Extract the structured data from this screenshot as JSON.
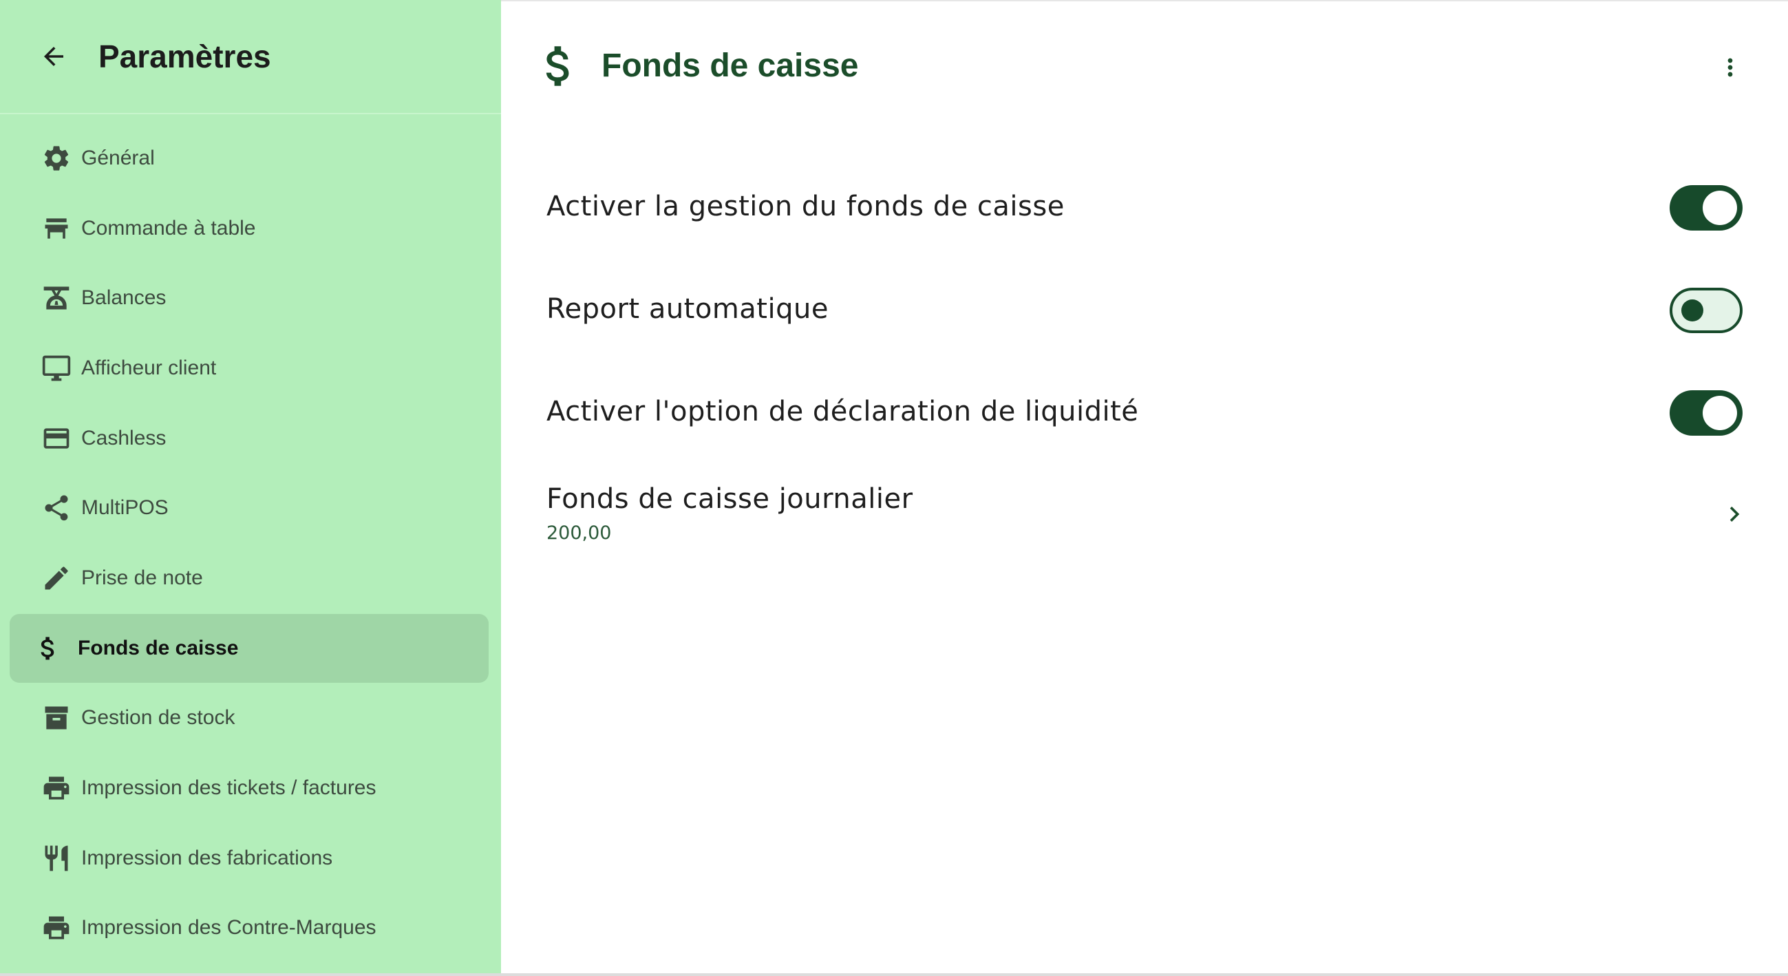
{
  "colors": {
    "sidebar_bg": "#b3eeba",
    "sidebar_active": "#9fd6a6",
    "accent": "#174a2b",
    "title": "#1b4d2a"
  },
  "sidebar": {
    "back_icon": "arrow-back-icon",
    "title": "Paramètres",
    "items": [
      {
        "label": "Général",
        "icon": "gear-icon",
        "active": false
      },
      {
        "label": "Commande à table",
        "icon": "table-icon",
        "active": false
      },
      {
        "label": "Balances",
        "icon": "scale-icon",
        "active": false
      },
      {
        "label": "Afficheur client",
        "icon": "monitor-icon",
        "active": false
      },
      {
        "label": "Cashless",
        "icon": "credit-card-icon",
        "active": false
      },
      {
        "label": "MultiPOS",
        "icon": "share-icon",
        "active": false
      },
      {
        "label": "Prise de note",
        "icon": "pencil-icon",
        "active": false
      },
      {
        "label": "Fonds de caisse",
        "icon": "dollar-icon",
        "active": true
      },
      {
        "label": "Gestion de stock",
        "icon": "archive-icon",
        "active": false
      },
      {
        "label": "Impression des tickets / factures",
        "icon": "printer-icon",
        "active": false
      },
      {
        "label": "Impression des fabrications",
        "icon": "cutlery-icon",
        "active": false
      },
      {
        "label": "Impression des Contre-Marques",
        "icon": "printer-icon",
        "active": false
      }
    ]
  },
  "main": {
    "title": "Fonds de caisse",
    "title_icon": "dollar-icon",
    "menu_icon": "more-vert-icon",
    "settings": [
      {
        "label": "Activer la gestion du fonds de caisse",
        "enabled": true
      },
      {
        "label": "Report automatique",
        "enabled": false
      },
      {
        "label": "Activer l'option de déclaration de liquidité",
        "enabled": true
      }
    ],
    "daily_fund": {
      "label": "Fonds de caisse journalier",
      "value": "200,00",
      "icon": "chevron-right-icon"
    }
  }
}
